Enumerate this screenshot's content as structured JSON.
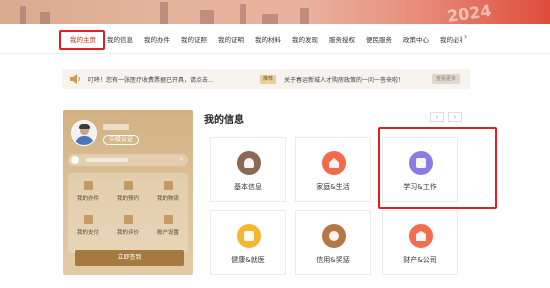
{
  "banner": {
    "year_text": "2024"
  },
  "nav": {
    "items": [
      {
        "label": "我的主页",
        "active": true
      },
      {
        "label": "我的信息"
      },
      {
        "label": "我的办件"
      },
      {
        "label": "我的证照"
      },
      {
        "label": "我的证明"
      },
      {
        "label": "我的材料"
      },
      {
        "label": "我的发现"
      },
      {
        "label": "服务授权"
      },
      {
        "label": "便民服务"
      },
      {
        "label": "政策中心"
      },
      {
        "label": "我的必看"
      }
    ],
    "more_icon": "chevron-right-icon"
  },
  "notice": {
    "icon": "speaker-icon",
    "text_1": "叮咚！您有一张医疗收费票据已开具，请点击...",
    "tag": "推荐",
    "text_2": "关于春运新城人才购房政策的一问一答来啦！",
    "more_label": "查看更多"
  },
  "profile": {
    "verify_label": "中级认证",
    "actions": [
      {
        "label": "我的办件",
        "icon": "document-icon"
      },
      {
        "label": "我的预约",
        "icon": "calendar-icon"
      },
      {
        "label": "我的物流",
        "icon": "delivery-icon"
      },
      {
        "label": "我的支付",
        "icon": "wallet-icon"
      },
      {
        "label": "我的评价",
        "icon": "comment-icon"
      },
      {
        "label": "账户设置",
        "icon": "user-settings-icon"
      }
    ],
    "button_label": "立即签到"
  },
  "info": {
    "title": "我的信息",
    "prev_label": "‹",
    "next_label": "›",
    "tiles": [
      {
        "label": "基本信息",
        "icon": "person-icon",
        "color": "#8a6a55"
      },
      {
        "label": "家庭&生活",
        "icon": "house-icon",
        "color": "#f26a4a"
      },
      {
        "label": "学习&工作",
        "icon": "briefcase-icon",
        "color": "#8b7be4"
      },
      {
        "label": "健康&就医",
        "icon": "medical-kit-icon",
        "color": "#f5b731"
      },
      {
        "label": "信用&奖惩",
        "icon": "credit-badge-icon",
        "color": "#b57842"
      },
      {
        "label": "财产&公司",
        "icon": "property-icon",
        "color": "#f0704e"
      }
    ]
  },
  "colors": {
    "accent_red": "#e02020",
    "gold": "#a67a3e"
  }
}
